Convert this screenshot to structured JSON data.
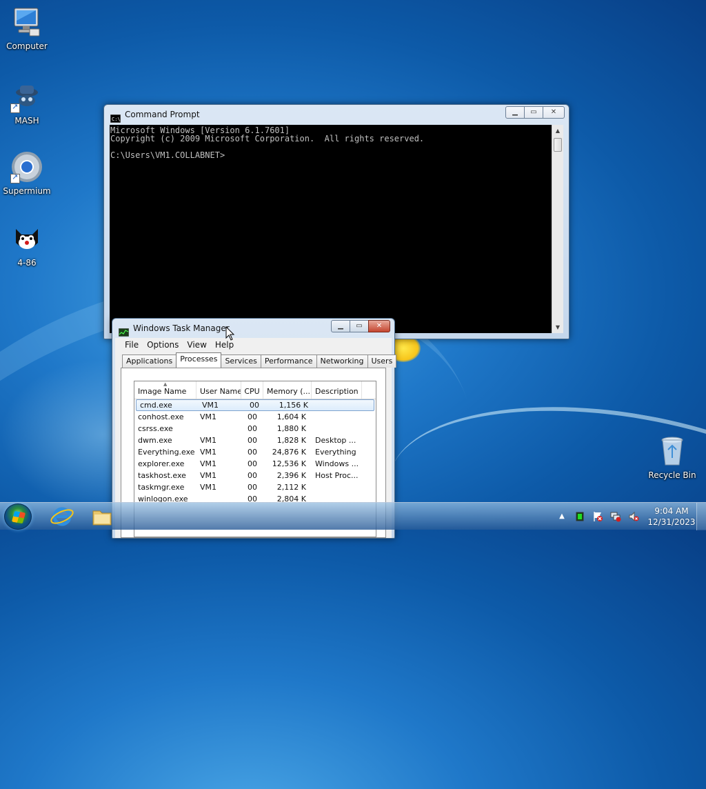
{
  "desktop": {
    "icons": [
      {
        "label": "Computer",
        "icon": "computer-icon"
      },
      {
        "label": "MASH",
        "icon": "mash-icon"
      },
      {
        "label": "Supermium",
        "icon": "supermium-icon"
      },
      {
        "label": "4-86",
        "icon": "cat-icon"
      },
      {
        "label": "Recycle Bin",
        "icon": "recycle-bin-icon"
      }
    ]
  },
  "cmd": {
    "title": "Command Prompt",
    "lines": [
      "Microsoft Windows [Version 6.1.7601]",
      "Copyright (c) 2009 Microsoft Corporation.  All rights reserved.",
      "",
      "C:\\Users\\VM1.COLLABNET>"
    ]
  },
  "taskmgr": {
    "title": "Windows Task Manager",
    "menu": [
      "File",
      "Options",
      "View",
      "Help"
    ],
    "tabs": [
      "Applications",
      "Processes",
      "Services",
      "Performance",
      "Networking",
      "Users"
    ],
    "active_tab": "Processes",
    "columns": [
      "Image Name",
      "User Name",
      "CPU",
      "Memory (...",
      "Description"
    ],
    "processes": [
      {
        "name": "cmd.exe",
        "user": "VM1",
        "cpu": "00",
        "mem": "1,156 K",
        "desc": ""
      },
      {
        "name": "conhost.exe",
        "user": "VM1",
        "cpu": "00",
        "mem": "1,604 K",
        "desc": ""
      },
      {
        "name": "csrss.exe",
        "user": "",
        "cpu": "00",
        "mem": "1,880 K",
        "desc": ""
      },
      {
        "name": "dwm.exe",
        "user": "VM1",
        "cpu": "00",
        "mem": "1,828 K",
        "desc": "Desktop ..."
      },
      {
        "name": "Everything.exe",
        "user": "VM1",
        "cpu": "00",
        "mem": "24,876 K",
        "desc": "Everything"
      },
      {
        "name": "explorer.exe",
        "user": "VM1",
        "cpu": "00",
        "mem": "12,536 K",
        "desc": "Windows ..."
      },
      {
        "name": "taskhost.exe",
        "user": "VM1",
        "cpu": "00",
        "mem": "2,396 K",
        "desc": "Host Proc..."
      },
      {
        "name": "taskmgr.exe",
        "user": "VM1",
        "cpu": "00",
        "mem": "2,112 K",
        "desc": ""
      },
      {
        "name": "winlogon.exe",
        "user": "",
        "cpu": "00",
        "mem": "2,804 K",
        "desc": ""
      }
    ],
    "selected_index": 0
  },
  "taskbar": {
    "pinned": [
      "internet-explorer-icon",
      "folder-icon"
    ],
    "tray_icons": [
      "show-hidden-icons-icon",
      "network-activity-icon",
      "action-center-flag-icon",
      "network-icon",
      "volume-muted-icon"
    ],
    "time": "9:04 AM",
    "date": "12/31/2023"
  },
  "colors": {
    "console_bg": "#000000",
    "console_fg": "#c0c0c0",
    "desktop_blue": "#1f78c9"
  }
}
